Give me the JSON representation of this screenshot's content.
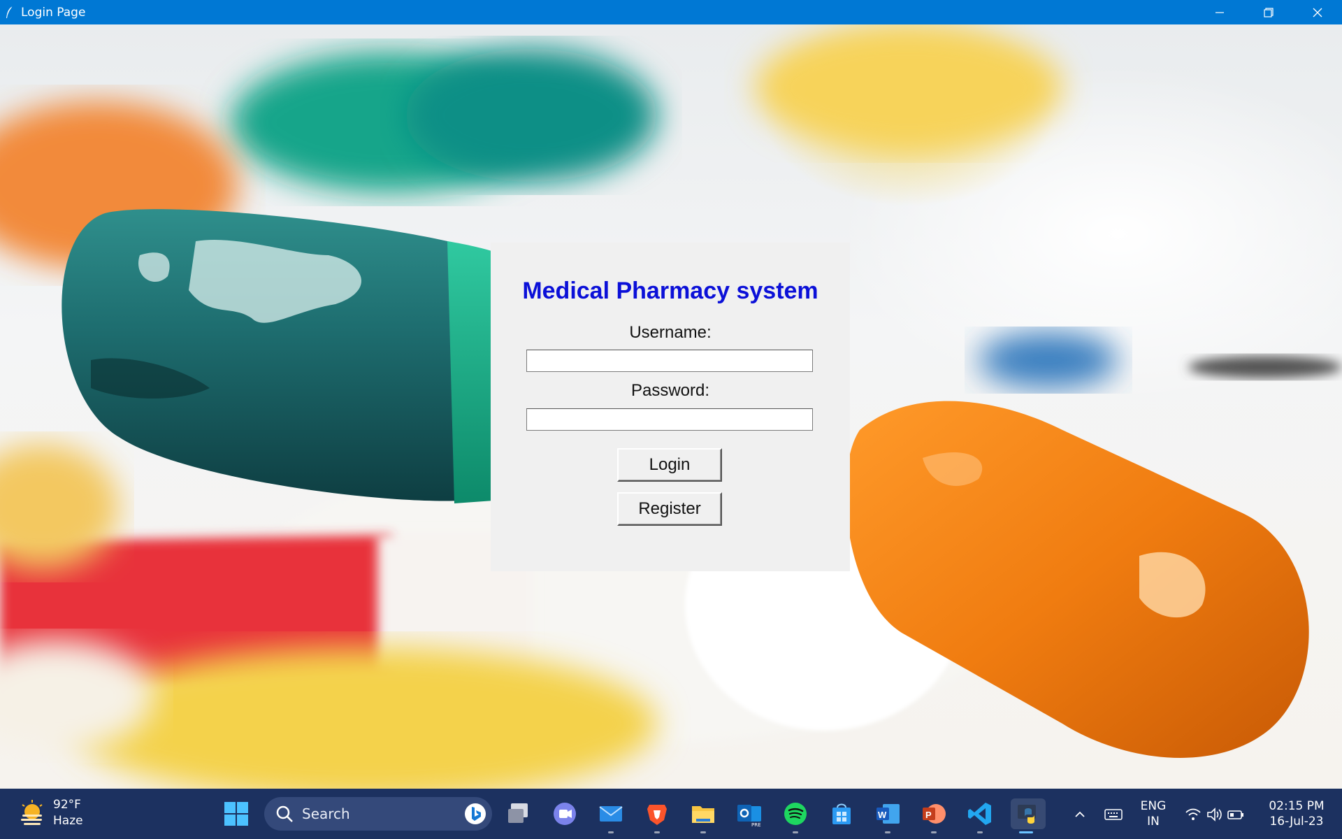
{
  "window": {
    "title": "Login Page",
    "controls": [
      "minimize",
      "restore",
      "close"
    ]
  },
  "login": {
    "heading": "Medical Pharmacy system",
    "username_label": "Username:",
    "username_value": "",
    "password_label": "Password:",
    "password_value": "",
    "login_button": "Login",
    "register_button": "Register",
    "heading_color": "#0b10d8"
  },
  "taskbar": {
    "weather": {
      "temperature": "92°F",
      "condition": "Haze"
    },
    "search_placeholder": "Search",
    "apps": [
      "windows-start-icon",
      "task-view-icon",
      "teams-icon",
      "mail-icon",
      "brave-icon",
      "file-explorer-icon",
      "outlook-icon",
      "spotify-icon",
      "store-icon",
      "word-icon",
      "powerpoint-icon",
      "vscode-icon",
      "python-icon"
    ],
    "tray": {
      "language": "ENG",
      "region": "IN",
      "time": "02:15 PM",
      "date": "16-Jul-23"
    },
    "colors": {
      "background": "#1c3160",
      "accent": "#0078d4"
    }
  }
}
